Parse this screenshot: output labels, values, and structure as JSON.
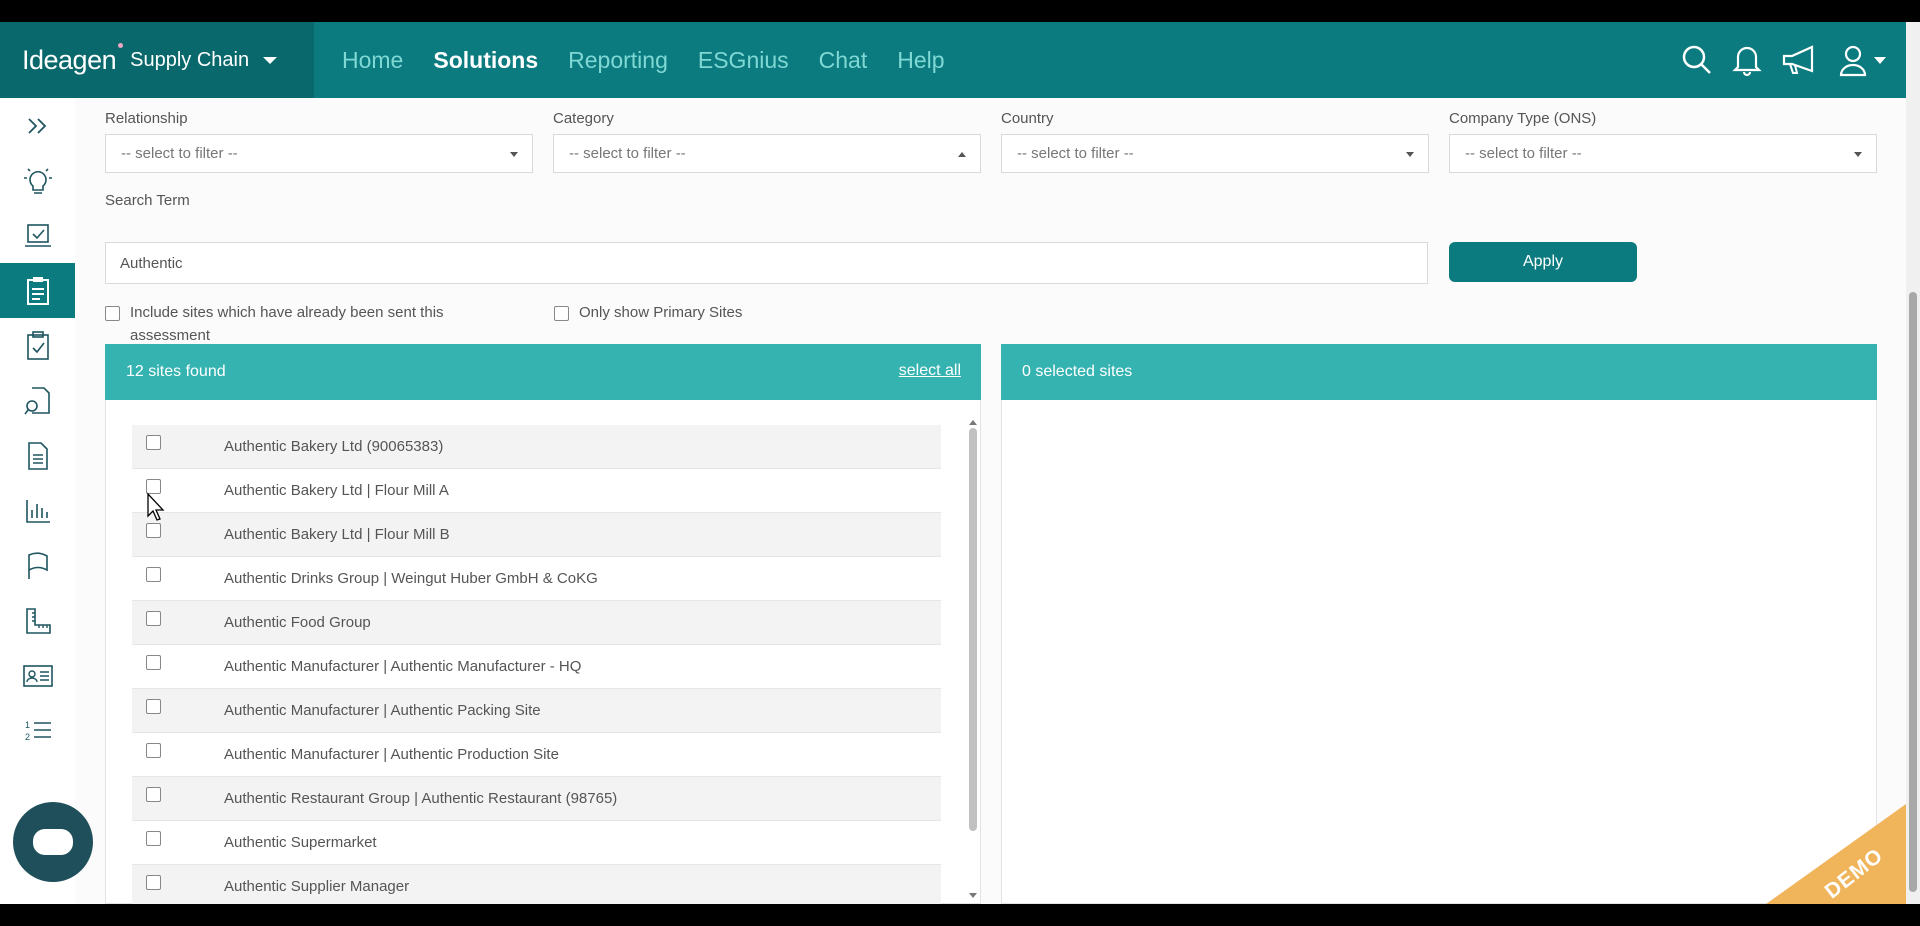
{
  "brand": {
    "logo": "Ideagen",
    "product": "Supply Chain"
  },
  "nav": {
    "items": [
      "Home",
      "Solutions",
      "Reporting",
      "ESGnius",
      "Chat",
      "Help"
    ],
    "active": "Solutions"
  },
  "filters": {
    "relationship": {
      "label": "Relationship",
      "placeholder": "-- select to filter --"
    },
    "category": {
      "label": "Category",
      "placeholder": "-- select to filter --"
    },
    "country": {
      "label": "Country",
      "placeholder": "-- select to filter --"
    },
    "company_type": {
      "label": "Company Type (ONS)",
      "placeholder": "-- select to filter --"
    }
  },
  "search": {
    "label": "Search Term",
    "value": "Authentic"
  },
  "apply_label": "Apply",
  "options": {
    "include_sent_line1": "Include sites which have already been sent this",
    "include_sent_line2": "assessment",
    "primary_only": "Only show Primary Sites"
  },
  "results": {
    "count_label": "12 sites found",
    "select_all": "select all",
    "sites": [
      "Authentic Bakery Ltd (90065383)",
      "Authentic Bakery Ltd | Flour Mill A",
      "Authentic Bakery Ltd | Flour Mill B",
      "Authentic Drinks Group | Weingut Huber GmbH & CoKG",
      "Authentic Food Group",
      "Authentic Manufacturer | Authentic Manufacturer - HQ",
      "Authentic Manufacturer | Authentic Packing Site",
      "Authentic Manufacturer | Authentic Production Site",
      "Authentic Restaurant Group | Authentic Restaurant (98765)",
      "Authentic Supermarket",
      "Authentic Supplier Manager"
    ]
  },
  "selected": {
    "count_label": "0 selected sites"
  },
  "demo_badge": "DEMO",
  "colors": {
    "nav": "#0b7b7f",
    "brand_bg": "#09686c",
    "panel_head": "#34b3b1",
    "demo": "#f0b45a"
  }
}
